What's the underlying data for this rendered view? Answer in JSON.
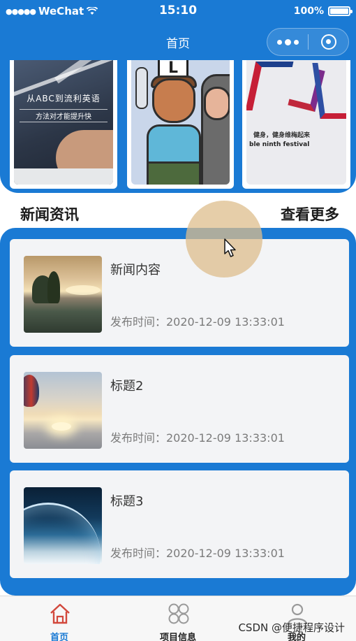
{
  "status_bar": {
    "carrier": "WeChat",
    "time": "15:10",
    "battery": "100%"
  },
  "nav_bar": {
    "title": "首页"
  },
  "banner": {
    "slides": [
      {
        "line1": "从ABC到流利英语",
        "line2": "方法对才能提升快"
      },
      {
        "sign": "L"
      },
      {
        "caption1": "健身，健身维梅起来",
        "caption2": "ble ninth festival"
      }
    ]
  },
  "news_section": {
    "title": "新闻资讯",
    "more": "查看更多",
    "items": [
      {
        "title": "新闻内容",
        "time": "发布时间：2020-12-09 13:33:01"
      },
      {
        "title": "标题2",
        "time": "发布时间：2020-12-09 13:33:01"
      },
      {
        "title": "标题3",
        "time": "发布时间：2020-12-09 13:33:01"
      }
    ]
  },
  "tab_bar": {
    "tabs": [
      {
        "label": "首页",
        "icon": "home-icon",
        "active": true
      },
      {
        "label": "项目信息",
        "icon": "grid-icon",
        "active": false
      },
      {
        "label": "我的",
        "icon": "user-icon",
        "active": false
      }
    ]
  },
  "watermark": "CSDN @便捷程序设计",
  "colors": {
    "primary": "#1a7ad4",
    "card": "#f3f4f6",
    "touch": "#debe8c"
  }
}
